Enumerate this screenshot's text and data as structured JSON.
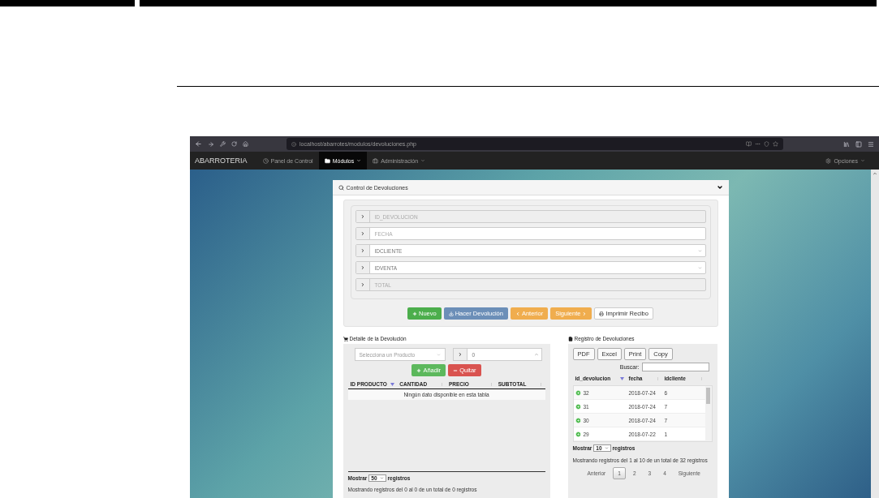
{
  "browser": {
    "url": "localhost/abarrotes/modulos/devoluciones.php"
  },
  "navbar": {
    "brand": "ABARROTERIA",
    "items": [
      {
        "label": "Panel de Control",
        "selected": false,
        "dropdown": false,
        "kind": "clock"
      },
      {
        "label": "Módulos",
        "selected": true,
        "dropdown": true,
        "kind": "folder"
      },
      {
        "label": "Administración",
        "selected": false,
        "dropdown": true,
        "kind": "briefcase"
      }
    ],
    "options": "Opciones"
  },
  "panel": {
    "title": "Control de Devoluciones",
    "fields": [
      {
        "placeholder": "ID_DEVOLUCION",
        "kind": "readonly"
      },
      {
        "placeholder": "FECHA",
        "kind": "text"
      },
      {
        "placeholder": "IDCLIENTE",
        "kind": "select"
      },
      {
        "placeholder": "IDVENTA",
        "kind": "select"
      },
      {
        "placeholder": "TOTAL",
        "kind": "readonly"
      }
    ],
    "buttons": [
      {
        "label": "Nuevo",
        "kind": "new"
      },
      {
        "label": "Hacer Devolución",
        "kind": "return"
      },
      {
        "label": "Anterior",
        "kind": "prev"
      },
      {
        "label": "Siguiente",
        "kind": "next"
      },
      {
        "label": "Imprimir Recibo",
        "kind": "print"
      }
    ]
  },
  "detail": {
    "title": "Detalle de la Devolución",
    "product_select": {
      "placeholder": "Selecciona un Producto"
    },
    "quantity": {
      "value": "0"
    },
    "buttons": [
      {
        "label": "Añadir",
        "kind": "add"
      },
      {
        "label": "Quitar",
        "kind": "remove"
      }
    ],
    "columns": [
      {
        "label": "ID PRODUCTO",
        "sorted": true
      },
      {
        "label": "CANTIDAD",
        "sorted": false
      },
      {
        "label": "PRECIO",
        "sorted": false
      },
      {
        "label": "SUBTOTAL",
        "sorted": false
      }
    ],
    "empty": "Ningún dato disponible en esta tabla",
    "length": {
      "before": "Mostrar",
      "value": "50",
      "after": "registros"
    },
    "info": "Mostrando registros del 0 al 0 de un total de 0 registros"
  },
  "register": {
    "title": "Registro de Devoluciones",
    "export_buttons": [
      "PDF",
      "Excel",
      "Print",
      "Copy"
    ],
    "search_label": "Buscar:",
    "columns": [
      {
        "label": "id_devolucion",
        "sorted": true
      },
      {
        "label": "fecha",
        "sorted": false
      },
      {
        "label": "idcliente",
        "sorted": false
      }
    ],
    "rows": [
      [
        "32",
        "2018-07-24",
        "6"
      ],
      [
        "31",
        "2018-07-24",
        "7"
      ],
      [
        "30",
        "2018-07-24",
        "7"
      ],
      [
        "29",
        "2018-07-22",
        "1"
      ]
    ],
    "length": {
      "before": "Mostrar",
      "value": "10",
      "after": "registros"
    },
    "info": "Mostrando registros del 1 al 10 de un total de 32 registros",
    "pagination": [
      {
        "label": "Anterior",
        "selected": false
      },
      {
        "label": "1",
        "selected": true
      },
      {
        "label": "2",
        "selected": false
      },
      {
        "label": "3",
        "selected": false
      },
      {
        "label": "4",
        "selected": false
      },
      {
        "label": "Siguiente",
        "selected": false
      }
    ]
  }
}
